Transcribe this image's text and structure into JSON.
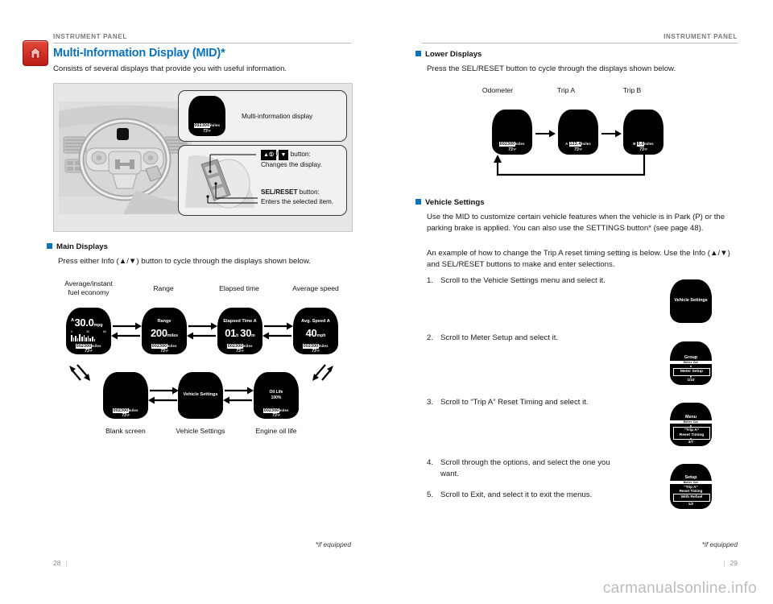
{
  "document": {
    "watermark": "carmanualsonline.info"
  },
  "left_page": {
    "running_head": "INSTRUMENT PANEL",
    "home_icon": "home-icon",
    "title": "Multi-Information Display (MID)*",
    "lede": "Consists of several displays that provide you with useful information.",
    "figure": {
      "callout1_text": "Multi-information display",
      "callout2_line1_label": "button:",
      "callout2_line1_desc": "Changes the display.",
      "callout2_line2_label": "SEL/RESET",
      "callout2_line2_label_suffix": " button:",
      "callout2_line2_desc": "Enters the selected item.",
      "mid_odometer": "002300",
      "mid_odometer_unit": "miles",
      "mid_temp": "73",
      "mid_temp_unit": "°F"
    },
    "main_displays": {
      "heading": "Main Displays",
      "instruction": "Press either Info (▲/▼) button to cycle through the displays shown below.",
      "captions_top": [
        "Average/instant\nfuel economy",
        "Range",
        "Elapsed time",
        "Average speed"
      ],
      "captions_bottom": [
        "Blank screen",
        "Vehicle Settings",
        "Engine oil life"
      ],
      "screens": [
        {
          "id": "avg-instant-fuel-economy",
          "trip_letter": "A",
          "value": "30.0",
          "unit": "mpg",
          "axis": [
            "0",
            "30",
            "60"
          ],
          "odometer": "002300",
          "odometer_unit": "miles",
          "temp": "73",
          "temp_unit": "°F"
        },
        {
          "id": "range",
          "label": "Range",
          "value": "200",
          "unit": "miles",
          "odometer": "002300",
          "odometer_unit": "miles",
          "temp": "73",
          "temp_unit": "°F"
        },
        {
          "id": "elapsed-time",
          "label": "Elapsed Time A",
          "value_h": "01",
          "unit_h": "h",
          "value_m": "30",
          "unit_m": "m",
          "odometer": "002300",
          "odometer_unit": "miles",
          "temp": "73",
          "temp_unit": "°F"
        },
        {
          "id": "average-speed",
          "label": "Avg. Speed A",
          "value": "40",
          "unit": "mph",
          "odometer": "002300",
          "odometer_unit": "miles",
          "temp": "73",
          "temp_unit": "°F"
        },
        {
          "id": "blank-screen",
          "label": "",
          "odometer": "002300",
          "odometer_unit": "miles",
          "temp": "73",
          "temp_unit": "°F"
        },
        {
          "id": "vehicle-settings",
          "label": "Vehicle Settings"
        },
        {
          "id": "engine-oil-life",
          "label_1": "Oil Life",
          "label_2": "100%",
          "odometer": "002300",
          "odometer_unit": "miles",
          "temp": "73",
          "temp_unit": "°F"
        }
      ]
    },
    "footnote": "*if equipped",
    "folio": "28"
  },
  "right_page": {
    "running_head": "INSTRUMENT PANEL",
    "lower_displays": {
      "heading": "Lower Displays",
      "instruction": "Press the SEL/RESET button to cycle through the displays shown below.",
      "captions": [
        "Odometer",
        "Trip A",
        "Trip B"
      ],
      "screens": [
        {
          "id": "odometer",
          "value": "002300",
          "unit": "miles",
          "temp": "73",
          "temp_unit": "°F"
        },
        {
          "id": "trip-a",
          "prefix": "A",
          "value": "123.4",
          "unit": "miles",
          "temp": "73",
          "temp_unit": "°F"
        },
        {
          "id": "trip-b",
          "prefix": "B",
          "value": "0.0",
          "unit": "miles",
          "temp": "73",
          "temp_unit": "°F"
        }
      ]
    },
    "vehicle_settings": {
      "heading": "Vehicle Settings",
      "para1": "Use the MID to customize certain vehicle features when the vehicle is in Park (P) or the parking brake is applied. You can also use the SETTINGS button* (see page 48).",
      "para2": "An example of how to change the Trip A reset timing setting is below. Use the Info (▲/▼) and SEL/RESET buttons to make and enter selections.",
      "steps": [
        {
          "n": "1.",
          "text": "Scroll to the Vehicle Settings menu and select it."
        },
        {
          "n": "2.",
          "text": "Scroll to Meter Setup and select it."
        },
        {
          "n": "3.",
          "text": "Scroll to “Trip A” Reset Timing and select it."
        },
        {
          "n": "4.",
          "text": "Scroll through the options, and select the one you want."
        },
        {
          "n": "5.",
          "text": "Scroll to Exit, and select it to exit the menus."
        }
      ],
      "thumbs": [
        {
          "id": "thumb-vehicle-settings",
          "center": "Vehicle Settings"
        },
        {
          "id": "thumb-meter-setup",
          "header": "Group",
          "subheader": "Meter   Car",
          "selected": "Meter Setup",
          "page": "1/10"
        },
        {
          "id": "thumb-trip-a-reset-timing",
          "header": "Menu",
          "subheader": "Meter   Car",
          "selected": "“Trip A”\nReset Timing",
          "page": "3/7"
        },
        {
          "id": "thumb-with-refuel",
          "header": "Setup",
          "subheader": "Meter   Car",
          "line2": "“Trip A”",
          "line3": "Reset Timing",
          "selected": "With Refuel",
          "page": "1/2"
        }
      ]
    },
    "footnote": "*if equipped",
    "folio": "29"
  }
}
